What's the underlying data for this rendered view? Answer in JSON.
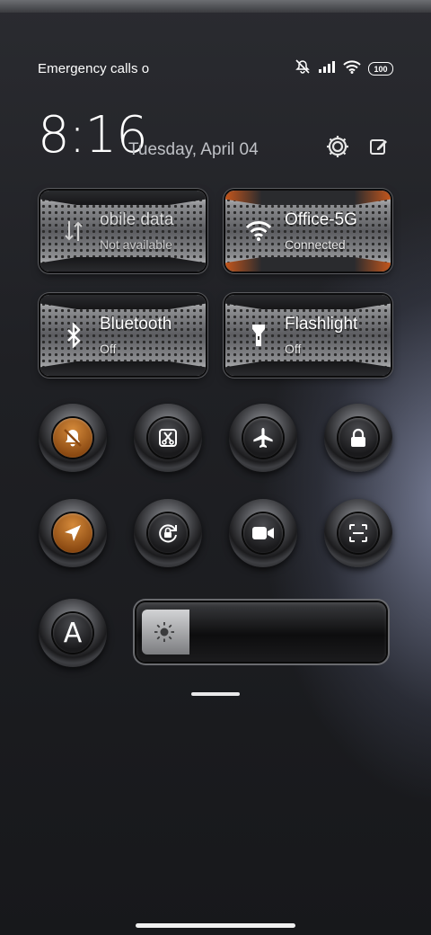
{
  "status_bar": {
    "carrier": "Emergency calls o",
    "battery": "100",
    "icons": [
      "mute-icon",
      "signal-icon",
      "wifi-icon",
      "battery-icon"
    ]
  },
  "header": {
    "time": "8:16",
    "date": "Tuesday, April 04",
    "icons": [
      "settings-icon",
      "edit-icon"
    ]
  },
  "tiles": [
    {
      "label": "obile data",
      "sub": "Not available",
      "icon": "mobile-data-icon",
      "state": "unavailable"
    },
    {
      "label": "Office-5G",
      "sub": "Connected",
      "icon": "wifi-icon",
      "state": "on"
    },
    {
      "label": "Bluetooth",
      "sub": "Off",
      "icon": "bluetooth-icon",
      "state": "off"
    },
    {
      "label": "Flashlight",
      "sub": "Off",
      "icon": "flashlight-icon",
      "state": "off"
    }
  ],
  "toggles": [
    {
      "icon": "silent-icon",
      "active": true
    },
    {
      "icon": "screenshot-icon",
      "active": false
    },
    {
      "icon": "airplane-icon",
      "active": false
    },
    {
      "icon": "lock-icon",
      "active": false
    },
    {
      "icon": "location-icon",
      "active": true
    },
    {
      "icon": "rotation-lock-icon",
      "active": false
    },
    {
      "icon": "screen-record-icon",
      "active": false
    },
    {
      "icon": "scanner-icon",
      "active": false
    }
  ],
  "brightness": {
    "auto_label": "A",
    "level_fraction": 0.2,
    "icon": "sun-icon"
  },
  "colors": {
    "accent_orange": "#c4651c",
    "background": "#1f2024",
    "text": "#ffffff"
  }
}
